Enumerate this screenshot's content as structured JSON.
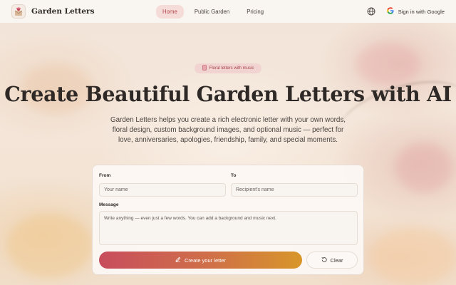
{
  "header": {
    "brand": "Garden Letters",
    "nav": [
      {
        "label": "Home",
        "active": true
      },
      {
        "label": "Public Garden",
        "active": false
      },
      {
        "label": "Pricing",
        "active": false
      }
    ],
    "language_icon": "globe-icon",
    "signin_label": "Sign in with Google"
  },
  "hero": {
    "badge": "Floral letters with music",
    "title": "Create Beautiful Garden Letters with AI",
    "subtitle": "Garden Letters helps you create a rich electronic letter with your own words, floral design, custom background images, and optional music — perfect for love, anniversaries, apologies, friendship, family, and special moments."
  },
  "form": {
    "from_label": "From",
    "from_placeholder": "Your name",
    "to_label": "To",
    "to_placeholder": "Recipient's name",
    "message_label": "Message",
    "message_placeholder": "Write anything — even just a few words. You can add a background and music next.",
    "create_label": "Create your letter",
    "clear_label": "Clear"
  },
  "colors": {
    "accent": "#b2464e",
    "button_gradient_start": "#c84d5d",
    "button_gradient_end": "#d8962a"
  }
}
